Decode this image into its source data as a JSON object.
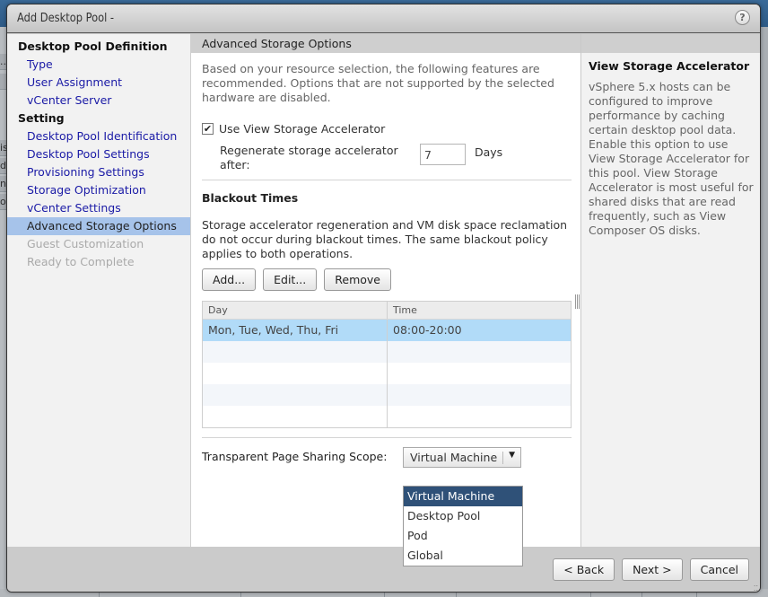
{
  "dialog": {
    "title": "Add Desktop Pool -",
    "help_icon": "question-mark-icon"
  },
  "background_app": {
    "left_fragments": [
      "",
      "...",
      "",
      "",
      "is",
      "d",
      "n",
      "o"
    ]
  },
  "nav": {
    "groups": [
      {
        "label": "Desktop Pool Definition",
        "items": [
          {
            "label": "Type",
            "state": "link"
          },
          {
            "label": "User Assignment",
            "state": "link"
          },
          {
            "label": "vCenter Server",
            "state": "link"
          }
        ]
      },
      {
        "label": "Setting",
        "items": [
          {
            "label": "Desktop Pool Identification",
            "state": "link"
          },
          {
            "label": "Desktop Pool Settings",
            "state": "link"
          },
          {
            "label": "Provisioning Settings",
            "state": "link"
          },
          {
            "label": "Storage Optimization",
            "state": "link"
          },
          {
            "label": "vCenter Settings",
            "state": "link"
          },
          {
            "label": "Advanced Storage Options",
            "state": "selected"
          },
          {
            "label": "Guest Customization",
            "state": "disabled"
          },
          {
            "label": "Ready to Complete",
            "state": "disabled"
          }
        ]
      }
    ]
  },
  "main": {
    "header": "Advanced Storage Options",
    "intro": "Based on your resource selection, the following features are recommended. Options that are not supported by the selected hardware are disabled.",
    "use_accelerator": {
      "label": "Use View Storage Accelerator",
      "checked": true,
      "check_glyph": "✔"
    },
    "regenerate": {
      "label": "Regenerate storage accelerator after:",
      "value": "7",
      "unit": "Days"
    },
    "blackout": {
      "title": "Blackout Times",
      "description": "Storage accelerator regeneration and VM disk space reclamation do not occur during blackout times. The same blackout policy applies to both operations.",
      "buttons": {
        "add": "Add...",
        "edit": "Edit...",
        "remove": "Remove"
      },
      "table": {
        "columns": [
          "Day",
          "Time"
        ],
        "rows": [
          {
            "day": "Mon, Tue, Wed, Thu, Fri",
            "time": "08:00-20:00",
            "selected": true
          },
          {
            "day": "",
            "time": ""
          },
          {
            "day": "",
            "time": ""
          },
          {
            "day": "",
            "time": ""
          },
          {
            "day": "",
            "time": ""
          }
        ]
      }
    },
    "tps": {
      "label": "Transparent Page Sharing Scope:",
      "selected": "Virtual Machine",
      "arrow_glyph": "▼",
      "options": [
        "Virtual Machine",
        "Desktop Pool",
        "Pod",
        "Global"
      ]
    }
  },
  "help_panel": {
    "title": "View Storage Accelerator",
    "text": "vSphere 5.x hosts can be configured to improve performance by caching certain desktop pool data. Enable this option to use View Storage Accelerator for this pool. View Storage Accelerator is most useful for shared disks that are read frequently, such as View Composer OS disks."
  },
  "footer": {
    "back": "< Back",
    "next": "Next >",
    "cancel": "Cancel"
  },
  "colors": {
    "nav_link": "#1a1aa6",
    "nav_selected_bg": "#a6c3ea",
    "table_selected_bg": "#b1dbf8",
    "dropdown_selected_bg": "#2f5178"
  }
}
